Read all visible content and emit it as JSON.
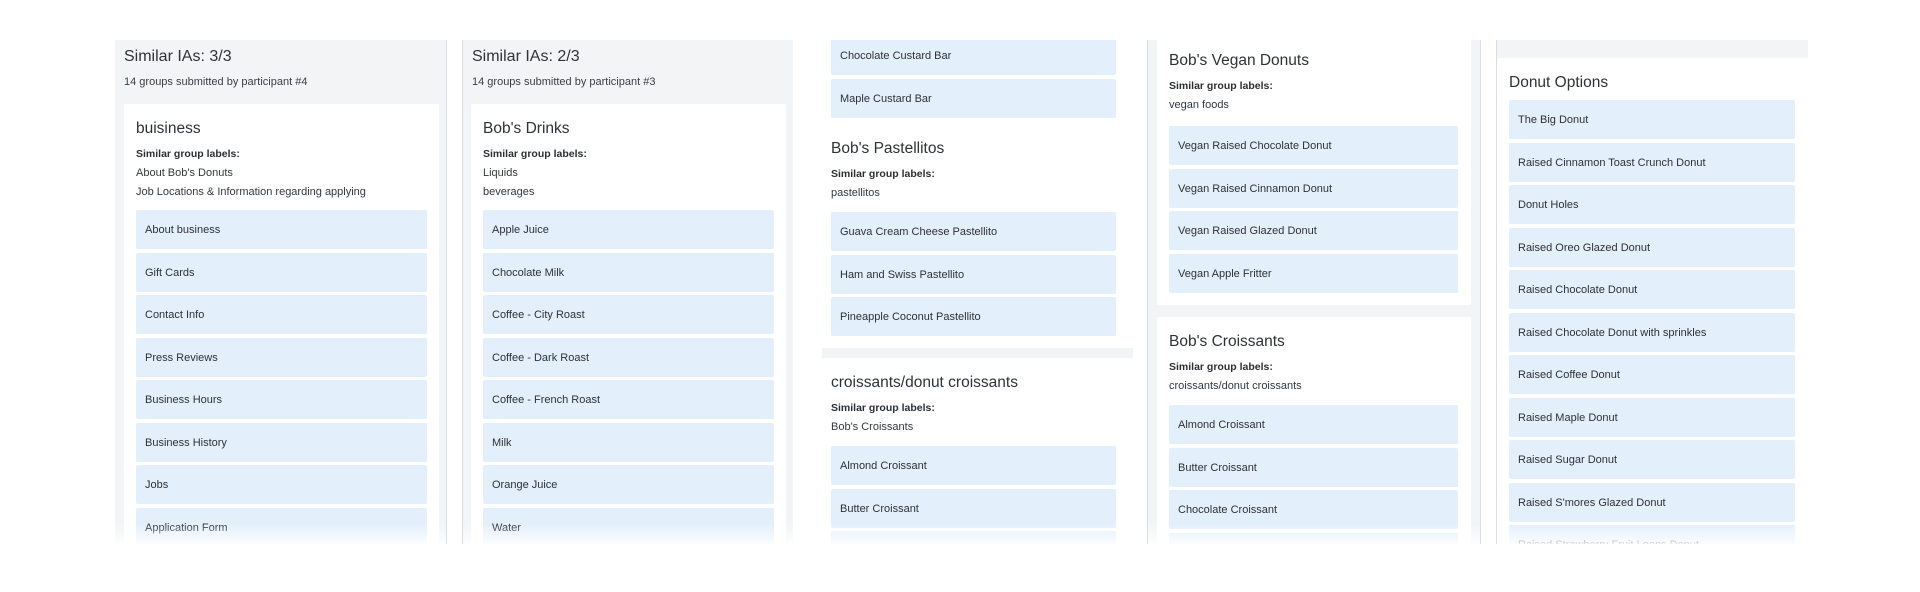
{
  "col1": {
    "title": "Similar IAs: 3/3",
    "subtitle": "14 groups submitted by participant #4",
    "card": {
      "title": "buisiness",
      "labels_heading": "Similar group labels:",
      "labels": [
        "About Bob's Donuts",
        "Job Locations & Information regarding applying"
      ],
      "items": [
        "About business",
        "Gift Cards",
        "Contact Info",
        "Press Reviews",
        "Business Hours",
        "Business History",
        "Jobs",
        "Application Form"
      ]
    }
  },
  "col2": {
    "title": "Similar IAs: 2/3",
    "subtitle": "14 groups submitted by participant #3",
    "card": {
      "title": "Bob's Drinks",
      "labels_heading": "Similar group labels:",
      "labels": [
        "Liquids",
        "beverages"
      ],
      "items": [
        "Apple Juice",
        "Chocolate Milk",
        "Coffee - City Roast",
        "Coffee - Dark Roast",
        "Coffee - French Roast",
        "Milk",
        "Orange Juice",
        "Water"
      ]
    }
  },
  "col3": {
    "top_items": [
      "Chocolate Custard Bar",
      "Maple Custard Bar"
    ],
    "card_pastellitos": {
      "title": "Bob's Pastellitos",
      "labels_heading": "Similar group labels:",
      "labels": [
        "pastellitos"
      ],
      "items": [
        "Guava Cream Cheese Pastellito",
        "Ham and Swiss Pastellito",
        "Pineapple Coconut Pastellito"
      ]
    },
    "card_croissants": {
      "title": "croissants/donut croissants",
      "labels_heading": "Similar group labels:",
      "labels": [
        "Bob's Croissants"
      ],
      "items": [
        "Almond Croissant",
        "Butter Croissant"
      ]
    }
  },
  "col4": {
    "card_vegan": {
      "title": "Bob's Vegan Donuts",
      "labels_heading": "Similar group labels:",
      "labels": [
        "vegan foods"
      ],
      "items": [
        "Vegan Raised Chocolate Donut",
        "Vegan Raised Cinnamon Donut",
        "Vegan Raised Glazed Donut",
        "Vegan Apple Fritter"
      ]
    },
    "card_croissants": {
      "title": "Bob's Croissants",
      "labels_heading": "Similar group labels:",
      "labels": [
        "croissants/donut croissants"
      ],
      "items": [
        "Almond Croissant",
        "Butter Croissant",
        "Chocolate Croissant"
      ]
    }
  },
  "col5": {
    "card": {
      "title": "Donut Options",
      "items": [
        "The Big Donut",
        "Raised Cinnamon Toast Crunch Donut",
        "Donut Holes",
        "Raised Oreo Glazed Donut",
        "Raised Chocolate Donut",
        "Raised Chocolate Donut with sprinkles",
        "Raised Coffee Donut",
        "Raised Maple Donut",
        "Raised Sugar Donut",
        "Raised S'mores Glazed Donut",
        "Raised Strawberry Fruit Loops Donut"
      ]
    }
  }
}
